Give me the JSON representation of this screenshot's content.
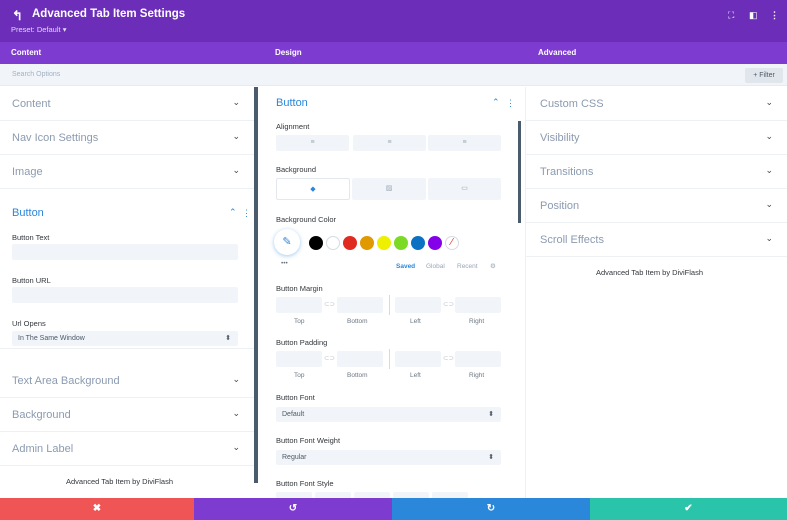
{
  "header": {
    "title": "Advanced Tab Item Settings",
    "preset": "Preset: Default",
    "preset_caret": "▾",
    "back_glyph": "↰",
    "expand_glyph": "⛶",
    "split_glyph": "◧",
    "more_glyph": "⋮",
    "bg": "#6c2eb9"
  },
  "tabs": {
    "content": "Content",
    "design": "Design",
    "advanced": "Advanced",
    "bg": "#7e3bd0"
  },
  "search": {
    "placeholder": "Search Options",
    "filter": "+ Filter"
  },
  "content_col": {
    "groups_top": [
      "Content",
      "Nav Icon Settings",
      "Image"
    ],
    "button_group": "Button",
    "button_text_label": "Button Text",
    "button_url_label": "Button URL",
    "url_opens_label": "Url Opens",
    "url_opens_value": "In The Same Window",
    "groups_bottom": [
      "Text Area Background",
      "Background",
      "Admin Label"
    ],
    "footer": "Advanced Tab Item by DiviFlash"
  },
  "design_col": {
    "group": "Button",
    "alignment_label": "Alignment",
    "background_label": "Background",
    "background_color_label": "Background Color",
    "palette": [
      "#000000",
      "#ffffff",
      "#e02b20",
      "#e09900",
      "#edf000",
      "#7cda24",
      "#0c71c3",
      "#8300e9"
    ],
    "more": "•••",
    "saved": "Saved",
    "global": "Global",
    "recent": "Recent",
    "margin_label": "Button Margin",
    "padding_label": "Button Padding",
    "sides": [
      "Top",
      "Bottom",
      "Left",
      "Right"
    ],
    "font_label": "Button Font",
    "font_value": "Default",
    "weight_label": "Button Font Weight",
    "weight_value": "Regular",
    "style_label": "Button Font Style",
    "accent": "#2b87da"
  },
  "advanced_col": {
    "groups": [
      "Custom CSS",
      "Visibility",
      "Transitions",
      "Position",
      "Scroll Effects"
    ],
    "footer": "Advanced Tab Item by DiviFlash"
  },
  "footer_bar": {
    "cancel": "✖",
    "undo": "↺",
    "redo": "↻",
    "save": "✔",
    "colors": [
      "#ef5555",
      "#7e3bd0",
      "#2b87da",
      "#29c4a9"
    ]
  }
}
